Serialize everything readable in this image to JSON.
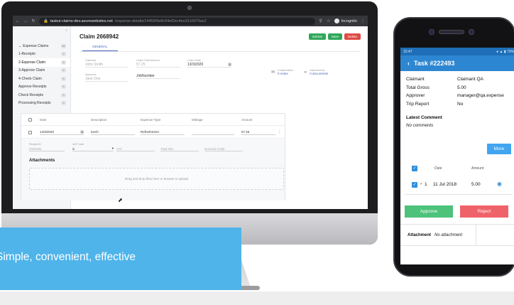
{
  "browser": {
    "url_host": "taskui-claims-dev.azurewebsites.net",
    "url_path": "/expense-details/14459/5e8c94ef2ec4ee3110076ac2",
    "incognito_label": "Incognito"
  },
  "sidebar": {
    "items": [
      {
        "label": "Expense Claims",
        "count": "00"
      },
      {
        "label": "1-Receipts",
        "count": "0"
      },
      {
        "label": "2-Expense Claim",
        "count": "0"
      },
      {
        "label": "3-Approve Claim",
        "count": "0"
      },
      {
        "label": "4-Check Claim",
        "count": "0"
      },
      {
        "label": "Approve Receipts",
        "count": "0"
      },
      {
        "label": "Check Receipts",
        "count": "0"
      },
      {
        "label": "Processing Receipts",
        "count": "0"
      }
    ]
  },
  "claim": {
    "title": "Claim 2668942",
    "buttons": {
      "submit": "Submit",
      "save": "Save",
      "delete": "Delete"
    },
    "tab": "GENERAL",
    "fields": {
      "claimant_label": "Claimant",
      "claimant_value": "John Smith",
      "total_label": "Claim Total Amount",
      "total_value": "57.25",
      "date_label": "Claim Date",
      "date_value": "13/3/2020",
      "approver_label": "Approver",
      "approver_value": "Jane Doe",
      "jobnumber_label": "",
      "jobnumber_value": "JobNumber"
    },
    "collaboration": {
      "title": "Collaboration",
      "value": "0 notes"
    },
    "attachments_info": {
      "title": "Attachments",
      "value": "0 documents"
    },
    "table": {
      "headers": [
        "Date",
        "Description",
        "Expense Type",
        "Mileage",
        "Amount"
      ],
      "row": {
        "date": "14/3/2020",
        "description": "lunch",
        "expense_type": "Refreshment",
        "mileage": "",
        "amount": "57.25"
      },
      "detail": {
        "receipt_label": "Receipt ID",
        "receipt_value": "2025482",
        "vat_code_label": "VAT Code",
        "vat_code_value": "S",
        "vat_label": "VAT",
        "total_net_label": "Total Net",
        "nominal_label": "Nominal Code"
      },
      "attachments_title": "Attachments",
      "dropzone_text": "Drag and drop files here or browse to upload"
    }
  },
  "banner": {
    "tagline": "Simple, convenient, effective"
  },
  "phone": {
    "status_time": "15:47",
    "status_right": "● ▲ ▮ 70%",
    "title": "Task #222493",
    "rows": [
      {
        "k": "Claimant",
        "v": "Claimant QA"
      },
      {
        "k": "Total Gross",
        "v": "5.00"
      },
      {
        "k": "Approver",
        "v": "manager@qa.expense"
      },
      {
        "k": "Trip Report",
        "v": "No"
      }
    ],
    "latest_comment_title": "Latest Comment",
    "no_comments": "No comments",
    "more": "More",
    "table_headers": {
      "date": "Date",
      "amount": "Amount"
    },
    "table_row": {
      "index": "1",
      "date": "11 Jul 2018",
      "amount": "5.00"
    },
    "approve": "Approve",
    "reject": "Reject",
    "attachment_label": "Attachment",
    "no_attachment": "No attachment"
  }
}
